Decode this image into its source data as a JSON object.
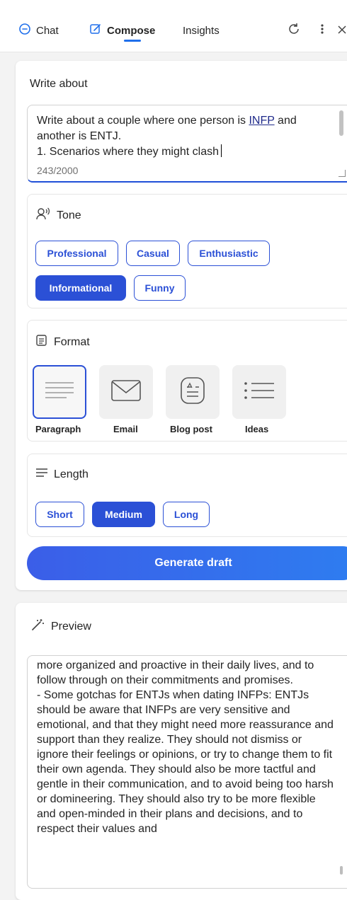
{
  "nav": {
    "tabs": [
      {
        "label": "Chat",
        "icon": "chat-bubble-icon"
      },
      {
        "label": "Compose",
        "icon": "compose-edit-icon"
      },
      {
        "label": "Insights"
      }
    ],
    "active_tab": "Compose",
    "right_icons": [
      "refresh-icon",
      "more-vertical-icon",
      "close-icon"
    ],
    "accent_color": "#1f6feb"
  },
  "compose": {
    "write_label": "Write about",
    "input_lines": [
      "Write about a couple where one person is ",
      "INFP",
      " and another is ENTJ.",
      "1. Scenarios where they might clash"
    ],
    "counter": "243/2000",
    "tone": {
      "title": "Tone",
      "options": [
        "Professional",
        "Casual",
        "Enthusiastic",
        "Informational",
        "Funny"
      ],
      "selected": "Informational"
    },
    "format": {
      "title": "Format",
      "options": [
        "Paragraph",
        "Email",
        "Blog post",
        "Ideas"
      ],
      "selected": "Paragraph"
    },
    "length": {
      "title": "Length",
      "options": [
        "Short",
        "Medium",
        "Long"
      ],
      "selected": "Medium"
    },
    "generate_label": "Generate draft",
    "brand_color": "#2b50d6"
  },
  "preview": {
    "title": "Preview",
    "text": "more organized and proactive in their daily lives, and to follow through on their commitments and promises.\n- Some gotchas for ENTJs when dating INFPs: ENTJs should be aware that INFPs are very sensitive and emotional, and that they might need more reassurance and support than they realize. They should not dismiss or ignore their feelings or opinions, or try to change them to fit their own agenda. They should also be more tactful and gentle in their communication, and to avoid being too harsh or domineering. They should also try to be more flexible and open-minded in their plans and decisions, and to respect their values and"
  }
}
